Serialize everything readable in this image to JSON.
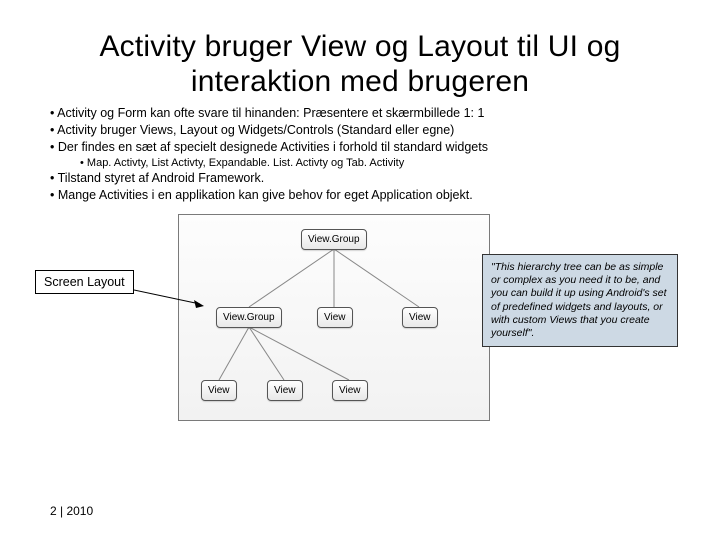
{
  "title": "Activity bruger View og Layout til UI og interaktion med brugeren",
  "bullets": {
    "b1": "• Activity og Form kan ofte svare til hinanden: Præsentere et skærmbillede 1: 1",
    "b2": "• Activity bruger Views, Layout og Widgets/Controls (Standard eller egne)",
    "b3": "• Der findes en sæt af specielt designede Activities i forhold til standard widgets",
    "b3a": "• Map. Activty, List Activty, Expandable. List. Activty og Tab. Activity",
    "b4": "• Tilstand styret af Android Framework.",
    "b5": "• Mange Activities i en applikation kan give behov for eget Application objekt."
  },
  "screen_layout_label": "Screen Layout",
  "nodes": {
    "root": "View.Group",
    "mid_left": "View.Group",
    "mid_center": "View",
    "mid_right": "View",
    "bot_left": "View",
    "bot_center": "View",
    "bot_right": "View"
  },
  "quote": "\"This hierarchy tree can be as simple or complex as you need it to be, and you can build it up using Android's set of predefined widgets and layouts, or with custom Views that you create yourself\".",
  "footer": "2 | 2010"
}
